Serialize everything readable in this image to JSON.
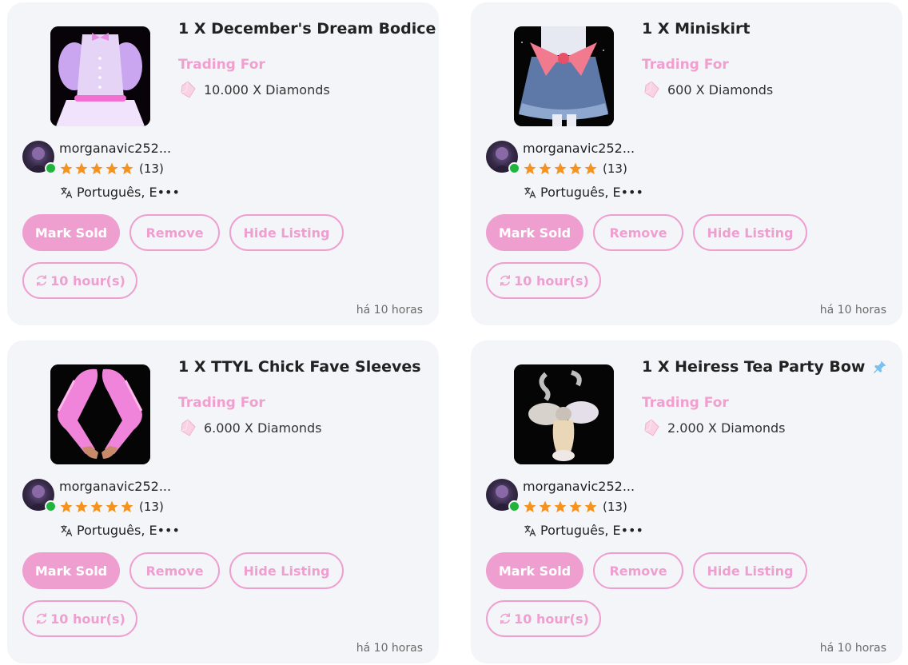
{
  "colors": {
    "accent": "#ee9fd0",
    "card_bg": "#f4f5f8",
    "online": "#1fb53c",
    "star": "#f6921e",
    "pin": "#7cc0ee"
  },
  "listings": [
    {
      "title": "1 X December's Dream Bodice",
      "trading_label": "Trading For",
      "price": "10.000 X Diamonds",
      "seller": "morganavic252...",
      "rating_count": "(13)",
      "language": "Português, E•••",
      "buttons": {
        "mark_sold": "Mark Sold",
        "remove": "Remove",
        "hide": "Hide Listing",
        "time": "10 hour(s)"
      },
      "time_ago": "há 10 horas",
      "pinned": false
    },
    {
      "title": "1 X Miniskirt",
      "trading_label": "Trading For",
      "price": "600 X Diamonds",
      "seller": "morganavic252...",
      "rating_count": "(13)",
      "language": "Português, E•••",
      "buttons": {
        "mark_sold": "Mark Sold",
        "remove": "Remove",
        "hide": "Hide Listing",
        "time": "10 hour(s)"
      },
      "time_ago": "há 10 horas",
      "pinned": false
    },
    {
      "title": "1 X TTYL Chick Fave Sleeves",
      "trading_label": "Trading For",
      "price": "6.000 X Diamonds",
      "seller": "morganavic252...",
      "rating_count": "(13)",
      "language": "Português, E•••",
      "buttons": {
        "mark_sold": "Mark Sold",
        "remove": "Remove",
        "hide": "Hide Listing",
        "time": "10 hour(s)"
      },
      "time_ago": "há 10 horas",
      "pinned": false
    },
    {
      "title": "1 X Heiress Tea Party Bow",
      "trading_label": "Trading For",
      "price": "2.000 X Diamonds",
      "seller": "morganavic252...",
      "rating_count": "(13)",
      "language": "Português, E•••",
      "buttons": {
        "mark_sold": "Mark Sold",
        "remove": "Remove",
        "hide": "Hide Listing",
        "time": "10 hour(s)"
      },
      "time_ago": "há 10 horas",
      "pinned": true
    }
  ]
}
